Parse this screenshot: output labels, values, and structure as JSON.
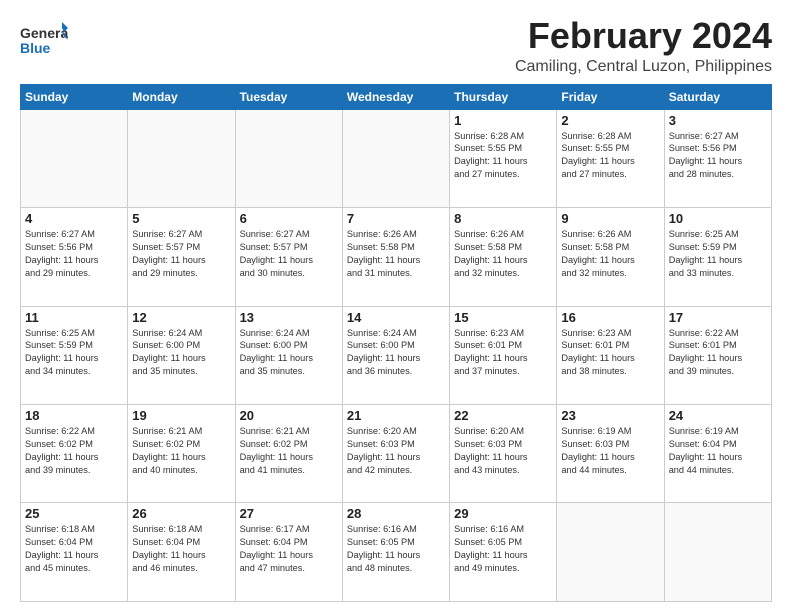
{
  "header": {
    "logo_line1": "General",
    "logo_line2": "Blue",
    "month_title": "February 2024",
    "location": "Camiling, Central Luzon, Philippines"
  },
  "days_of_week": [
    "Sunday",
    "Monday",
    "Tuesday",
    "Wednesday",
    "Thursday",
    "Friday",
    "Saturday"
  ],
  "weeks": [
    [
      {
        "day": "",
        "info": ""
      },
      {
        "day": "",
        "info": ""
      },
      {
        "day": "",
        "info": ""
      },
      {
        "day": "",
        "info": ""
      },
      {
        "day": "1",
        "info": "Sunrise: 6:28 AM\nSunset: 5:55 PM\nDaylight: 11 hours\nand 27 minutes."
      },
      {
        "day": "2",
        "info": "Sunrise: 6:28 AM\nSunset: 5:55 PM\nDaylight: 11 hours\nand 27 minutes."
      },
      {
        "day": "3",
        "info": "Sunrise: 6:27 AM\nSunset: 5:56 PM\nDaylight: 11 hours\nand 28 minutes."
      }
    ],
    [
      {
        "day": "4",
        "info": "Sunrise: 6:27 AM\nSunset: 5:56 PM\nDaylight: 11 hours\nand 29 minutes."
      },
      {
        "day": "5",
        "info": "Sunrise: 6:27 AM\nSunset: 5:57 PM\nDaylight: 11 hours\nand 29 minutes."
      },
      {
        "day": "6",
        "info": "Sunrise: 6:27 AM\nSunset: 5:57 PM\nDaylight: 11 hours\nand 30 minutes."
      },
      {
        "day": "7",
        "info": "Sunrise: 6:26 AM\nSunset: 5:58 PM\nDaylight: 11 hours\nand 31 minutes."
      },
      {
        "day": "8",
        "info": "Sunrise: 6:26 AM\nSunset: 5:58 PM\nDaylight: 11 hours\nand 32 minutes."
      },
      {
        "day": "9",
        "info": "Sunrise: 6:26 AM\nSunset: 5:58 PM\nDaylight: 11 hours\nand 32 minutes."
      },
      {
        "day": "10",
        "info": "Sunrise: 6:25 AM\nSunset: 5:59 PM\nDaylight: 11 hours\nand 33 minutes."
      }
    ],
    [
      {
        "day": "11",
        "info": "Sunrise: 6:25 AM\nSunset: 5:59 PM\nDaylight: 11 hours\nand 34 minutes."
      },
      {
        "day": "12",
        "info": "Sunrise: 6:24 AM\nSunset: 6:00 PM\nDaylight: 11 hours\nand 35 minutes."
      },
      {
        "day": "13",
        "info": "Sunrise: 6:24 AM\nSunset: 6:00 PM\nDaylight: 11 hours\nand 35 minutes."
      },
      {
        "day": "14",
        "info": "Sunrise: 6:24 AM\nSunset: 6:00 PM\nDaylight: 11 hours\nand 36 minutes."
      },
      {
        "day": "15",
        "info": "Sunrise: 6:23 AM\nSunset: 6:01 PM\nDaylight: 11 hours\nand 37 minutes."
      },
      {
        "day": "16",
        "info": "Sunrise: 6:23 AM\nSunset: 6:01 PM\nDaylight: 11 hours\nand 38 minutes."
      },
      {
        "day": "17",
        "info": "Sunrise: 6:22 AM\nSunset: 6:01 PM\nDaylight: 11 hours\nand 39 minutes."
      }
    ],
    [
      {
        "day": "18",
        "info": "Sunrise: 6:22 AM\nSunset: 6:02 PM\nDaylight: 11 hours\nand 39 minutes."
      },
      {
        "day": "19",
        "info": "Sunrise: 6:21 AM\nSunset: 6:02 PM\nDaylight: 11 hours\nand 40 minutes."
      },
      {
        "day": "20",
        "info": "Sunrise: 6:21 AM\nSunset: 6:02 PM\nDaylight: 11 hours\nand 41 minutes."
      },
      {
        "day": "21",
        "info": "Sunrise: 6:20 AM\nSunset: 6:03 PM\nDaylight: 11 hours\nand 42 minutes."
      },
      {
        "day": "22",
        "info": "Sunrise: 6:20 AM\nSunset: 6:03 PM\nDaylight: 11 hours\nand 43 minutes."
      },
      {
        "day": "23",
        "info": "Sunrise: 6:19 AM\nSunset: 6:03 PM\nDaylight: 11 hours\nand 44 minutes."
      },
      {
        "day": "24",
        "info": "Sunrise: 6:19 AM\nSunset: 6:04 PM\nDaylight: 11 hours\nand 44 minutes."
      }
    ],
    [
      {
        "day": "25",
        "info": "Sunrise: 6:18 AM\nSunset: 6:04 PM\nDaylight: 11 hours\nand 45 minutes."
      },
      {
        "day": "26",
        "info": "Sunrise: 6:18 AM\nSunset: 6:04 PM\nDaylight: 11 hours\nand 46 minutes."
      },
      {
        "day": "27",
        "info": "Sunrise: 6:17 AM\nSunset: 6:04 PM\nDaylight: 11 hours\nand 47 minutes."
      },
      {
        "day": "28",
        "info": "Sunrise: 6:16 AM\nSunset: 6:05 PM\nDaylight: 11 hours\nand 48 minutes."
      },
      {
        "day": "29",
        "info": "Sunrise: 6:16 AM\nSunset: 6:05 PM\nDaylight: 11 hours\nand 49 minutes."
      },
      {
        "day": "",
        "info": ""
      },
      {
        "day": "",
        "info": ""
      }
    ]
  ]
}
